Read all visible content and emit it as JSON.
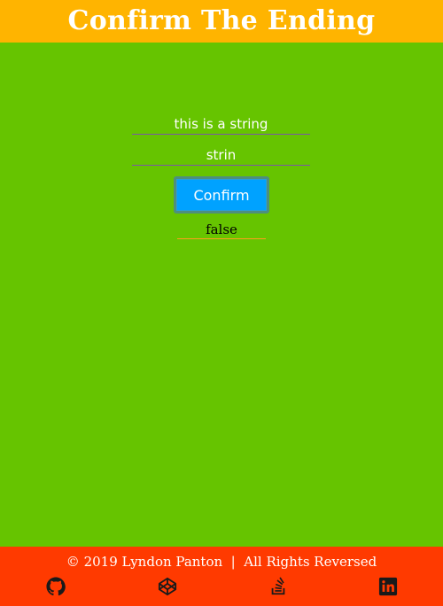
{
  "header": {
    "title": "Confirm The Ending"
  },
  "form": {
    "string_value": "this is a string",
    "target_value": "strin",
    "confirm_label": "Confirm",
    "result": "false"
  },
  "footer": {
    "copyright": "© 2019 Lyndon Panton  |  All Rights Reversed",
    "social_icons": [
      "github-icon",
      "codepen-icon",
      "stack-overflow-icon",
      "linkedin-icon"
    ]
  },
  "colors": {
    "header_bg": "#ffb400",
    "main_bg": "#66c400",
    "footer_bg": "#ff3a00",
    "button_bg": "#00a2ff"
  }
}
